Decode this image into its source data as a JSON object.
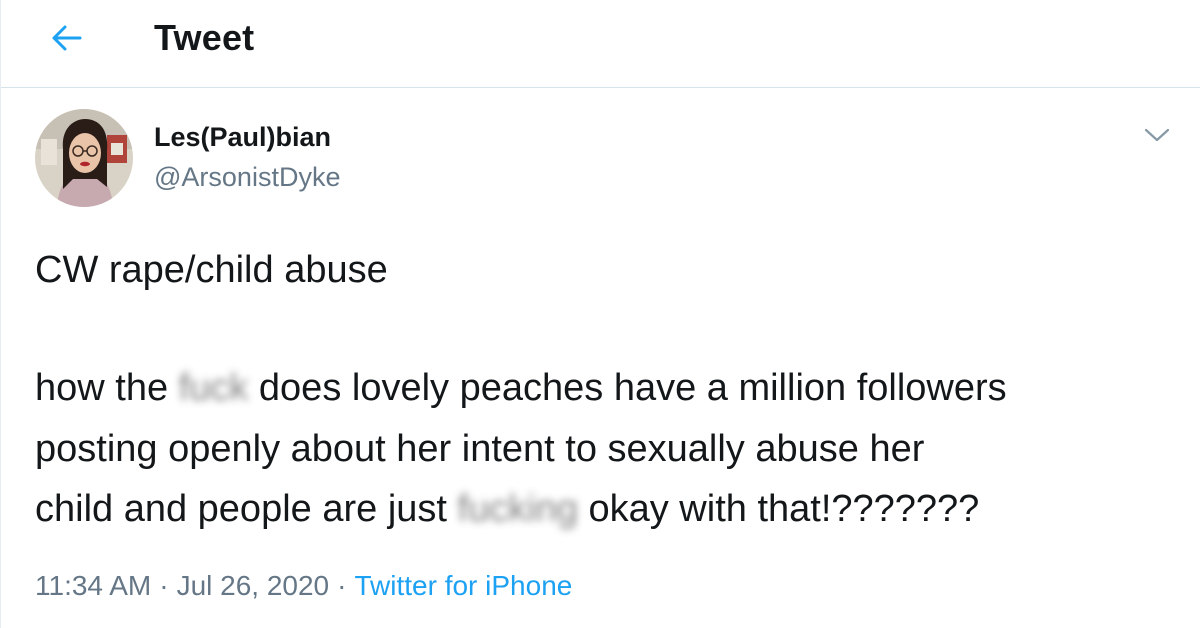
{
  "header": {
    "title": "Tweet"
  },
  "tweet": {
    "author_name": "Les(Paul)bian",
    "author_handle": "@ArsonistDyke",
    "content_warning": "CW rape/child abuse",
    "line2_a": "how the ",
    "line2_censored": "fuck",
    "line2_b": " does lovely peaches have a million followers",
    "line3": "posting openly about her intent to sexually abuse her",
    "line4_a": "child and people are just ",
    "line4_censored": "fucking",
    "line4_b": " okay with that!???????",
    "time": "11:34 AM",
    "date": "Jul 26, 2020",
    "separator": "·",
    "source": "Twitter for iPhone"
  },
  "icons": {
    "back": "back-arrow-icon",
    "caret": "chevron-down-icon",
    "avatar": "profile-photo"
  },
  "colors": {
    "accent": "#1da1f2",
    "text": "#14171a",
    "secondary": "#657786",
    "border": "#e6ecf0"
  }
}
